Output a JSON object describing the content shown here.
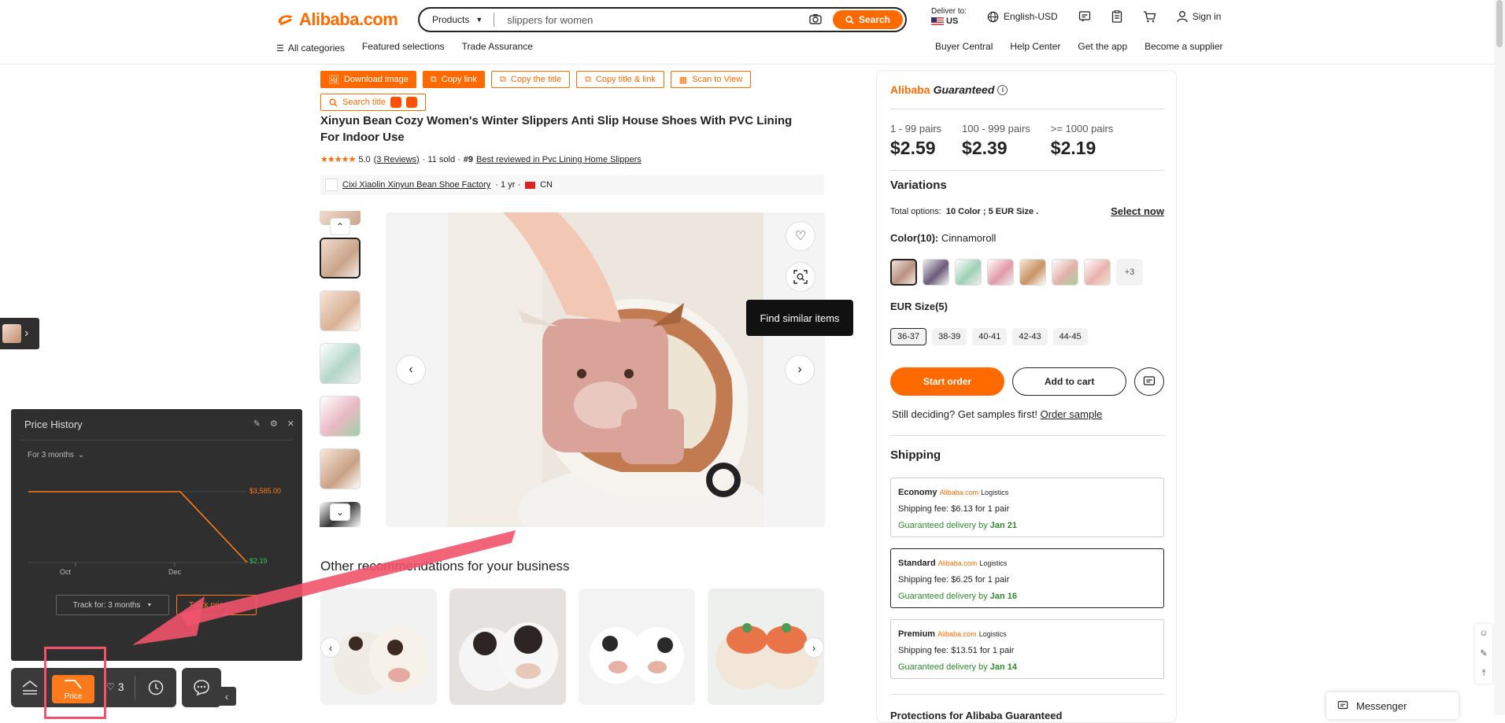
{
  "header": {
    "logo_text": "Alibaba.com",
    "search_category": "Products",
    "search_value": "slippers for women",
    "search_button": "Search",
    "deliver_label": "Deliver to:",
    "deliver_country": "US",
    "language": "English-USD",
    "sign_in": "Sign in",
    "nav_left": [
      "All categories",
      "Featured selections",
      "Trade Assurance"
    ],
    "nav_right": [
      "Buyer Central",
      "Help Center",
      "Get the app",
      "Become a supplier"
    ]
  },
  "toolbar": {
    "download_image": "Download image",
    "copy_link": "Copy link",
    "copy_title": "Copy the title",
    "copy_title_link": "Copy title & link",
    "scan_to_view": "Scan to View",
    "search_title": "Search title"
  },
  "product": {
    "title": "Xinyun Bean Cozy Women's Winter Slippers Anti Slip House Shoes With PVC Lining For Indoor Use",
    "rating": "5.0",
    "reviews": "(3 Reviews)",
    "sold": "· 11 sold ·",
    "rank_no": "#9",
    "rank_text": "Best reviewed in Pvc Lining Home Slippers",
    "supplier": "Cixi Xiaolin Xinyun Bean Shoe Factory",
    "supplier_years": "· 1 yr ·",
    "supplier_country": "CN",
    "tooltip": "Find similar items"
  },
  "recommendations": {
    "title": "Other recommendations for your business"
  },
  "right_panel": {
    "guaranteed_brand": "Alibaba",
    "guaranteed_word": "Guaranteed",
    "tiers": [
      {
        "label": "1 - 99 pairs",
        "price": "$2.59"
      },
      {
        "label": "100 - 999 pairs",
        "price": "$2.39"
      },
      {
        "label": ">= 1000 pairs",
        "price": "$2.19"
      }
    ],
    "variations_title": "Variations",
    "total_options_label": "Total options:",
    "total_options_value": "10 Color ; 5 EUR Size .",
    "select_now": "Select now",
    "color_label": "Color(10):",
    "color_value": "Cinnamoroll",
    "more_colors": "+3",
    "size_label": "EUR Size(5)",
    "sizes": [
      "36-37",
      "38-39",
      "40-41",
      "42-43",
      "44-45"
    ],
    "start_order": "Start order",
    "add_to_cart": "Add to cart",
    "samples_text": "Still deciding? Get samples first!",
    "order_sample": "Order sample",
    "shipping_title": "Shipping",
    "shipping": [
      {
        "name": "Economy",
        "fee": "Shipping fee: $6.13 for 1 pair",
        "delivery_prefix": "Guaranteed delivery by",
        "date": "Jan 21"
      },
      {
        "name": "Standard",
        "fee": "Shipping fee: $6.25 for 1 pair",
        "delivery_prefix": "Guaranteed delivery by",
        "date": "Jan 16"
      },
      {
        "name": "Premium",
        "fee": "Shipping fee: $13.51 for 1 pair",
        "delivery_prefix": "Guaranteed delivery by",
        "date": "Jan 14"
      }
    ],
    "logistics_brand": "Alibaba.com",
    "logistics_word": "Logistics",
    "protections": "Protections for Alibaba Guaranteed"
  },
  "price_history": {
    "title": "Price History",
    "range": "For 3 months",
    "high_label": "$3,585.00",
    "low_label": "$2.19",
    "x_labels": [
      "Oct",
      "Dec"
    ],
    "track_for": "Track for: 3 months",
    "track_price": "Track price",
    "favorites_count": "3",
    "price_button": "Price"
  },
  "messenger": "Messenger",
  "colors": {
    "accent": "#ff6a00",
    "green": "#2c8a2c",
    "annotation": "#f0536b"
  }
}
